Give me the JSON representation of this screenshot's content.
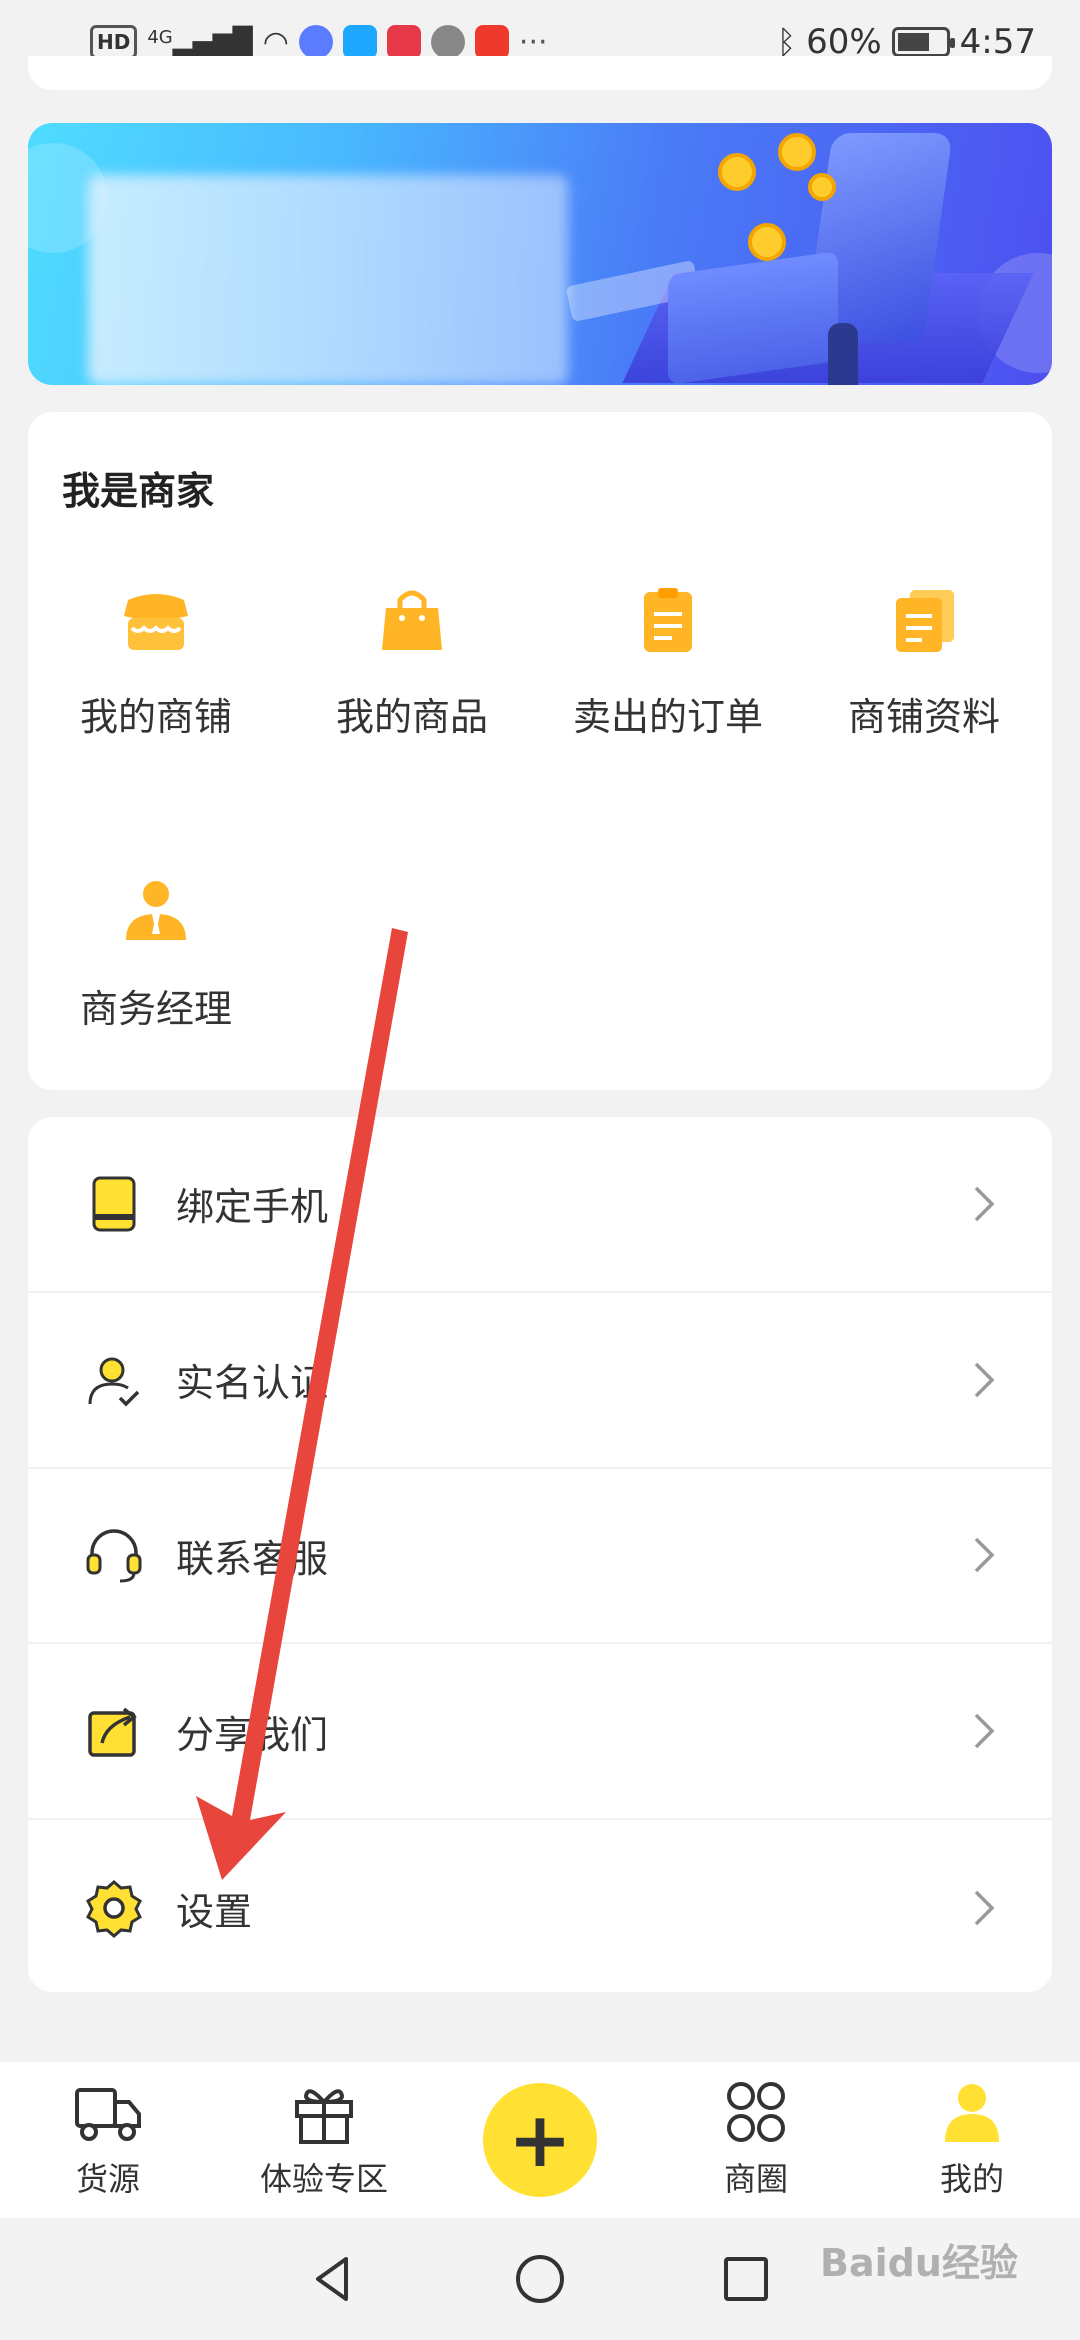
{
  "status_bar": {
    "hd": "HD",
    "network": "4G",
    "more": "···",
    "battery": "60%",
    "time": "4:57"
  },
  "merchant": {
    "title": "我是商家",
    "items": [
      {
        "label": "我的商铺",
        "icon": "store-icon"
      },
      {
        "label": "我的商品",
        "icon": "shopping-bag-icon"
      },
      {
        "label": "卖出的订单",
        "icon": "clipboard-order-icon"
      },
      {
        "label": "商铺资料",
        "icon": "documents-icon"
      },
      {
        "label": "商务经理",
        "icon": "business-manager-icon"
      }
    ]
  },
  "menu": {
    "items": [
      {
        "label": "绑定手机",
        "icon": "phone-icon"
      },
      {
        "label": "实名认证",
        "icon": "user-verified-icon"
      },
      {
        "label": "联系客服",
        "icon": "headset-icon"
      },
      {
        "label": "分享我们",
        "icon": "share-icon"
      },
      {
        "label": "设置",
        "icon": "settings-gear-icon"
      }
    ]
  },
  "bottom_nav": {
    "items": [
      {
        "label": "货源",
        "icon": "truck-icon"
      },
      {
        "label": "体验专区",
        "icon": "gift-icon"
      },
      {
        "label": "商圈",
        "icon": "grid-circles-icon"
      },
      {
        "label": "我的",
        "icon": "profile-icon"
      }
    ],
    "fab": "+"
  },
  "colors": {
    "accent_yellow": "#ffe033",
    "icon_orange": "#ffb526",
    "annotation_red": "#e8453c"
  },
  "watermark": "Baidu经验"
}
